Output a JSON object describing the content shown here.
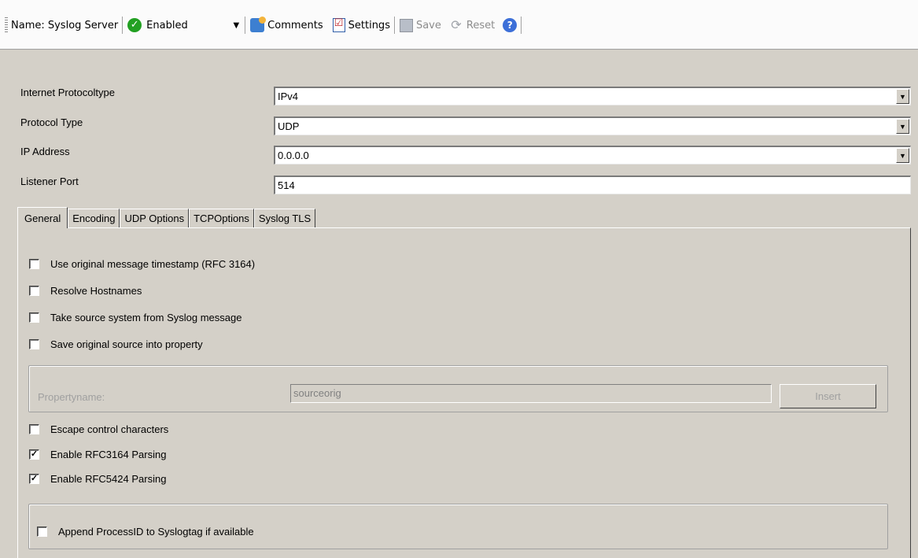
{
  "toolbar": {
    "name_label": "Name: Syslog Server",
    "status_value": "Enabled",
    "comments_label": "Comments",
    "settings_label": "Settings",
    "save_label": "Save",
    "reset_label": "Reset"
  },
  "form": {
    "ip_protocol_label": "Internet Protocoltype",
    "ip_protocol_value": "IPv4",
    "protocol_type_label": "Protocol Type",
    "protocol_type_value": "UDP",
    "ip_address_label": "IP Address",
    "ip_address_value": "0.0.0.0",
    "listener_port_label": "Listener Port",
    "listener_port_value": "514"
  },
  "tabs": [
    {
      "label": "General"
    },
    {
      "label": "Encoding"
    },
    {
      "label": "UDP Options"
    },
    {
      "label": "TCPOptions"
    },
    {
      "label": "Syslog TLS"
    }
  ],
  "general": {
    "use_original_timestamp": {
      "label": "Use original message timestamp (RFC 3164)",
      "checked": false
    },
    "resolve_hostnames": {
      "label": "Resolve Hostnames",
      "checked": false
    },
    "take_source_system": {
      "label": "Take source system from Syslog message",
      "checked": false
    },
    "save_original_source": {
      "label": "Save original source into property",
      "checked": false
    },
    "propertyname_label": "Propertyname:",
    "propertyname_value": "sourceorig",
    "insert_label": "Insert",
    "escape_control": {
      "label": "Escape control characters",
      "checked": false
    },
    "enable_rfc3164": {
      "label": "Enable RFC3164 Parsing",
      "checked": true
    },
    "enable_rfc5424": {
      "label": "Enable RFC5424 Parsing",
      "checked": true
    },
    "append_processid": {
      "label": "Append ProcessID to Syslogtag if available",
      "checked": false
    }
  },
  "colors": {
    "panel_bg": "#d4d0c8",
    "toolbar_bg": "#fbfbfb",
    "enabled_icon": "#22a022"
  }
}
